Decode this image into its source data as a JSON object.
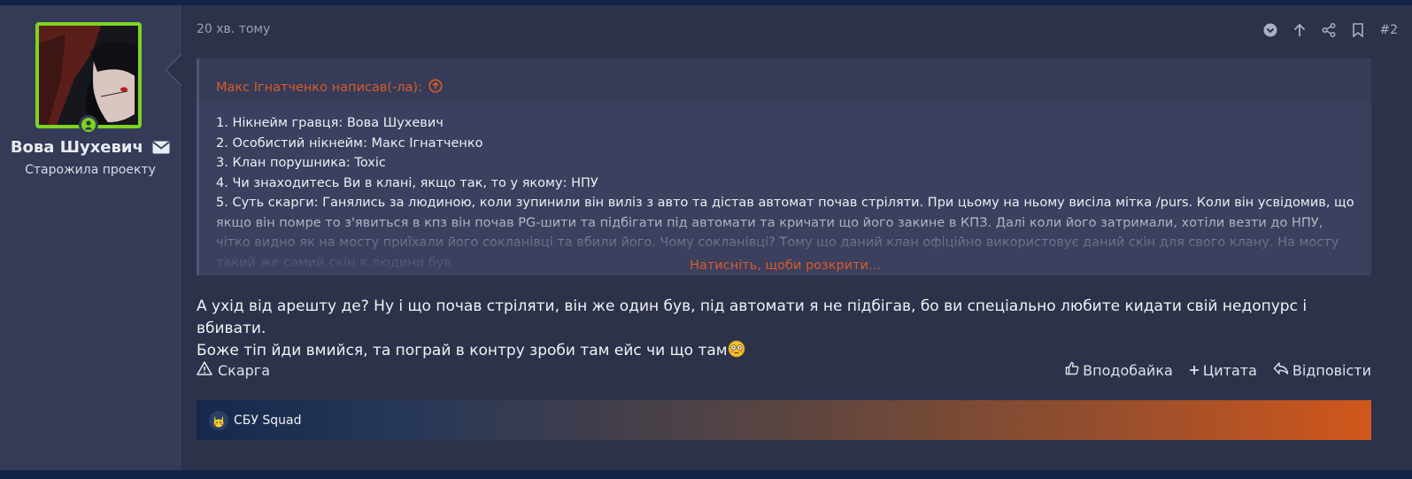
{
  "user": {
    "name": "Вова Шухевич",
    "title": "Старожила проекту",
    "status_color": "#7ed321"
  },
  "post": {
    "time": "20 хв. тому",
    "number": "#2",
    "actions_icons": [
      "chevron-down-icon",
      "arrow-up-icon",
      "share-icon",
      "bookmark-icon"
    ]
  },
  "quote": {
    "author_line": "Макс Ігнатченко написав(-ла):",
    "lines": [
      "1. Нікнейм гравця: Вова Шухевич",
      "2. Особистий нікнейм: Макс Ігнатченко",
      "3. Клан порушника: Toxic",
      "4. Чи знаходитесь Ви в клані, якщо так, то у якому: НПУ",
      "5. Суть скарги: Ганялись за людиною, коли зупинили він виліз з авто та дістав автомат почав стріляти. При цьому на ньому висіла мітка /purs. Коли він усвідомив, що якщо він помре то з'явиться в кпз він почав PG-шити та підбігати під автомати та кричати що його закине в КПЗ. Далі коли його затримали, хотіли везти до НПУ, чітко видно як на мосту приїхали його сокланівці та вбили його. Чому сокланівці? Тому що даний клан офіційно використовує даний скін для свого клану. На мосту такий же самий скін в людини був."
    ],
    "expand_label": "Натисніть, щоби розкрити..."
  },
  "message": {
    "line1": "А ухід від арешту де? Ну і що почав стріляти, він же один був, під автомати я не підбігав, бо ви спеціально любите кидати свій недопурс і вбивати.",
    "line2": "Боже тіп йди вмийся, та пограй в контру зроби там ейс чи що там"
  },
  "footer": {
    "report": "Скарга",
    "like": "Вподобайка",
    "quote": "Цитата",
    "reply": "Відповісти"
  },
  "signature": {
    "text": "СБУ Squad"
  },
  "colors": {
    "accent": "#d85a2a",
    "background": "#2c3249",
    "sidebar": "#353b57"
  }
}
